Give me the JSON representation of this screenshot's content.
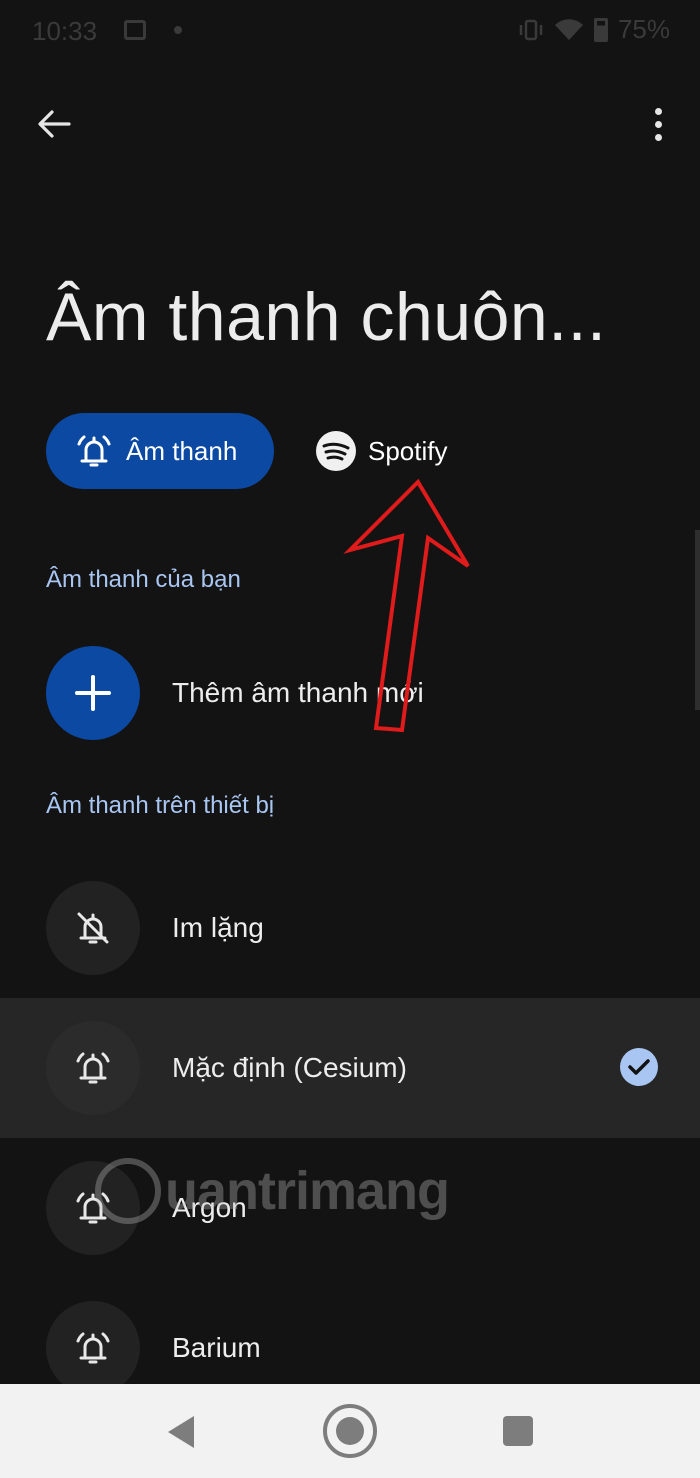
{
  "status_bar": {
    "time": "10:33",
    "battery": "75%"
  },
  "header": {
    "title": "Âm thanh chuôn..."
  },
  "chips": [
    {
      "label": "Âm thanh",
      "active": true,
      "icon": "alarm-bell-icon"
    },
    {
      "label": "Spotify",
      "active": false,
      "icon": "spotify-icon"
    }
  ],
  "sections": {
    "yours": "Âm thanh của bạn",
    "device": "Âm thanh trên thiết bị"
  },
  "add_sound": {
    "label": "Thêm âm thanh mới",
    "icon": "plus-icon"
  },
  "sounds": [
    {
      "label": "Im lặng",
      "icon": "bell-off-icon",
      "selected": false
    },
    {
      "label": "Mặc định (Cesium)",
      "icon": "alarm-bell-icon",
      "selected": true
    },
    {
      "label": "Argon",
      "icon": "alarm-bell-icon",
      "selected": false
    },
    {
      "label": "Barium",
      "icon": "alarm-bell-icon",
      "selected": false
    }
  ],
  "watermark": {
    "text": "uantrimang"
  },
  "colors": {
    "accent": "#0b49a3",
    "section_label": "#a9c6f2",
    "background": "#131313",
    "annotation": "#e01b1b"
  }
}
